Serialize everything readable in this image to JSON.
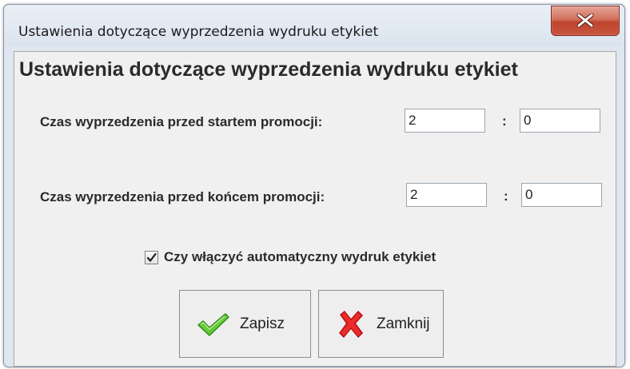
{
  "window": {
    "title": "Ustawienia dotyczące wyprzedzenia wydruku etykiet"
  },
  "dialog": {
    "heading": "Ustawienia dotyczące wyprzedzenia wydruku etykiet",
    "start_row": {
      "label": "Czas wyprzedzenia przed startem promocji:",
      "value1": "2",
      "separator": ":",
      "value2": "0"
    },
    "end_row": {
      "label": "Czas wyprzedzenia przed końcem promocji:",
      "value1": "2",
      "separator": ":",
      "value2": "0"
    },
    "auto_print": {
      "label": "Czy włączyć automatyczny wydruk etykiet",
      "checked": true
    },
    "buttons": {
      "save_label": "Zapisz",
      "close_label": "Zamknij"
    }
  },
  "icons": {
    "close": "close-icon",
    "save": "green-checkmark-icon",
    "cancel": "red-x-icon",
    "checkbox": "checkmark-icon"
  },
  "colors": {
    "close_button": "#c8563f",
    "save_icon": "#4caf2a",
    "cancel_icon": "#e02020"
  }
}
